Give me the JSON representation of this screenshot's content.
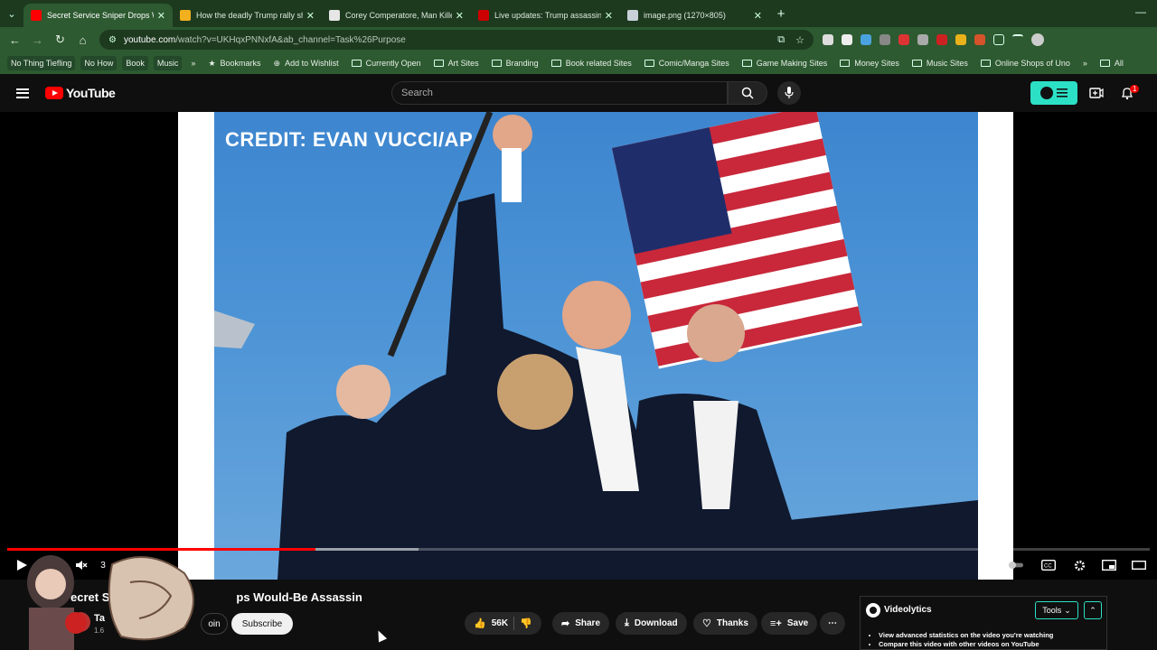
{
  "browser": {
    "tabs": [
      {
        "title": "Secret Service Sniper Drops W",
        "favicon_color": "#ff0000",
        "active": true
      },
      {
        "title": "How the deadly Trump rally sho",
        "favicon_color": "#f2b01e",
        "active": false
      },
      {
        "title": "Corey Comperatore, Man Killed",
        "favicon_color": "#e6e6e6",
        "active": false
      },
      {
        "title": "Live updates: Trump assassinati",
        "favicon_color": "#cc0000",
        "active": false
      },
      {
        "title": "image.png (1270×805)",
        "favicon_color": "#c8d0d8",
        "active": false
      }
    ],
    "url_host": "youtube.com",
    "url_rest": "/watch?v=UKHqxPNNxfA&ab_channel=Task%26Purpose",
    "bookmarks": [
      {
        "label": "No Thing Tiefling",
        "type": "chip"
      },
      {
        "label": "No How",
        "type": "chip"
      },
      {
        "label": "Book",
        "type": "chip"
      },
      {
        "label": "Music",
        "type": "chip"
      },
      {
        "label": "»",
        "type": "more"
      },
      {
        "label": "Bookmarks",
        "type": "star"
      },
      {
        "label": "Add to Wishlist",
        "type": "link"
      },
      {
        "label": "Currently Open",
        "type": "folder"
      },
      {
        "label": "Art Sites",
        "type": "folder"
      },
      {
        "label": "Branding",
        "type": "folder"
      },
      {
        "label": "Book related Sites",
        "type": "folder"
      },
      {
        "label": "Comic/Manga Sites",
        "type": "folder"
      },
      {
        "label": "Game Making Sites",
        "type": "folder"
      },
      {
        "label": "Money Sites",
        "type": "folder"
      },
      {
        "label": "Music Sites",
        "type": "folder"
      },
      {
        "label": "Online Shops of Uno",
        "type": "folder"
      },
      {
        "label": "»",
        "type": "more"
      },
      {
        "label": "All",
        "type": "folder"
      }
    ]
  },
  "youtube": {
    "logo_text": "YouTube",
    "search_placeholder": "Search",
    "notification_count": "1"
  },
  "video": {
    "credit_text": "CREDIT: EVAN VUCCI/AP",
    "played_fraction": 0.27,
    "buffered_fraction": 0.36,
    "time_partial": "3",
    "title_visible_left": "ecret S",
    "title_visible_right": "ps Would-Be Assassin",
    "channel_name_partial": "Ta",
    "channel_subs_partial": "1.6",
    "join_label": "oin",
    "subscribe_label": "Subscribe",
    "actions": {
      "likes": "56K",
      "share": "Share",
      "download": "Download",
      "thanks": "Thanks",
      "save": "Save"
    }
  },
  "videolytics": {
    "name": "Videolytics",
    "header_button": "Tools",
    "bullets": [
      "View advanced statistics on the video you're watching",
      "Compare this video with other videos on YouTube"
    ]
  },
  "colors": {
    "tab_bar": "#1d3a1f",
    "toolbar": "#2d5a30",
    "yt_red": "#ff0000",
    "videolytics_accent": "#2ce0c6"
  }
}
